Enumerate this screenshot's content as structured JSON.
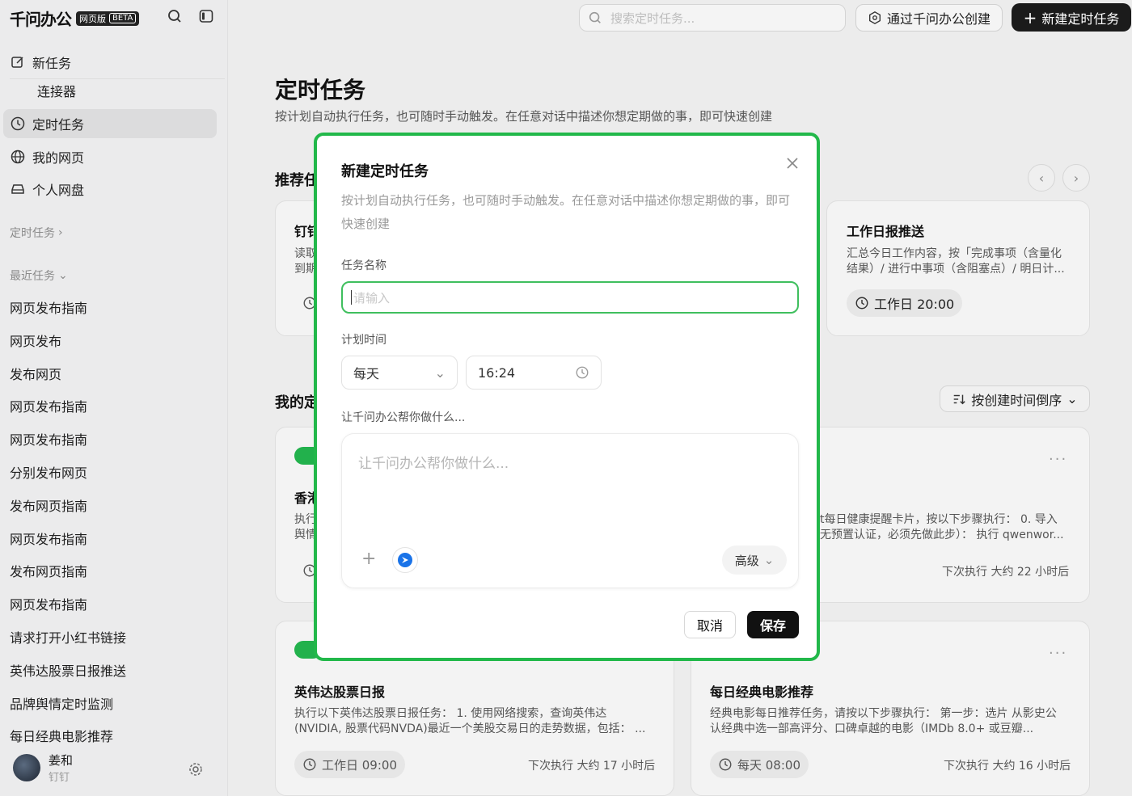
{
  "brand": {
    "name": "千问办公",
    "tag": "网页版",
    "beta": "BETA"
  },
  "sidebar": {
    "nav": [
      {
        "label": "新任务"
      },
      {
        "label": "连接器"
      },
      {
        "label": "定时任务"
      },
      {
        "label": "我的网页"
      },
      {
        "label": "个人网盘"
      }
    ],
    "scheduled_section": "定时任务",
    "recent_section": "最近任务",
    "recent": [
      "网页发布指南",
      "网页发布",
      "发布网页",
      "网页发布指南",
      "网页发布指南",
      "分别发布网页",
      "发布网页指南",
      "网页发布指南",
      "发布网页指南",
      "网页发布指南",
      "请求打开小红书链接",
      "英伟达股票日报推送",
      "品牌舆情定时监测",
      "每日经典电影推荐"
    ],
    "user": {
      "name": "姜和",
      "sub": "钉钉"
    }
  },
  "header": {
    "search_placeholder": "搜索定时任务...",
    "create_via_label": "通过千问办公创建",
    "new_task_label": "新建定时任务"
  },
  "page": {
    "title": "定时任务",
    "desc": "按计划自动执行任务，也可随时手动触发。在任意对话中描述你想定期做的事，即可快速创建",
    "recommended_label": "推荐任",
    "my_label": "我的定",
    "sort_label": "按创建时间倒序"
  },
  "rec_cards": [
    {
      "title": "钉钉",
      "desc1": "读取",
      "desc2": "到期"
    },
    {
      "title": "工作日报推送",
      "desc1": "汇总今日工作内容，按「完成事项（含量化",
      "desc2": "结果）/ 进行中事项（含阻塞点）/ 明日计...",
      "schedule": "工作日 20:00"
    }
  ],
  "my_cards": [
    {
      "title": "香港",
      "desc1": "执行",
      "desc2": "舆情"
    },
    {
      "desc1": "t每日健康提醒卡片，按以下步骤执行： 0. 导入",
      "desc2": "无预置认证，必须先做此步）： 执行 qwenwor...",
      "next": "下次执行 大约 22 小时后"
    },
    {
      "title": "英伟达股票日报",
      "desc1": "执行以下英伟达股票日报任务： 1. 使用网络搜索，查询英伟达",
      "desc2": "(NVIDIA, 股票代码NVDA)最近一个美股交易日的走势数据，包括： ...",
      "schedule": "工作日 09:00",
      "next": "下次执行 大约 17 小时后"
    },
    {
      "title": "每日经典电影推荐",
      "desc1": "经典电影每日推荐任务，请按以下步骤执行： 第一步：选片 从影史公",
      "desc2": "认经典中选一部高评分、口碑卓越的电影（IMDb 8.0+ 或豆瓣...",
      "schedule": "每天 08:00",
      "next": "下次执行 大约 16 小时后"
    }
  ],
  "modal": {
    "title": "新建定时任务",
    "desc": "按计划自动执行任务，也可随时手动触发。在任意对话中描述你想定期做的事，即可快速创建",
    "name_label": "任务名称",
    "name_placeholder": "请输入",
    "time_label": "计划时间",
    "frequency": "每天",
    "time": "16:24",
    "prompt_label": "让千问办公帮你做什么...",
    "prompt_placeholder": "让千问办公帮你做什么...",
    "advanced": "高级",
    "cancel": "取消",
    "save": "保存"
  },
  "colors": {
    "accent_green": "#22b84a",
    "toggle_green": "#22b14c",
    "dark": "#111111"
  }
}
